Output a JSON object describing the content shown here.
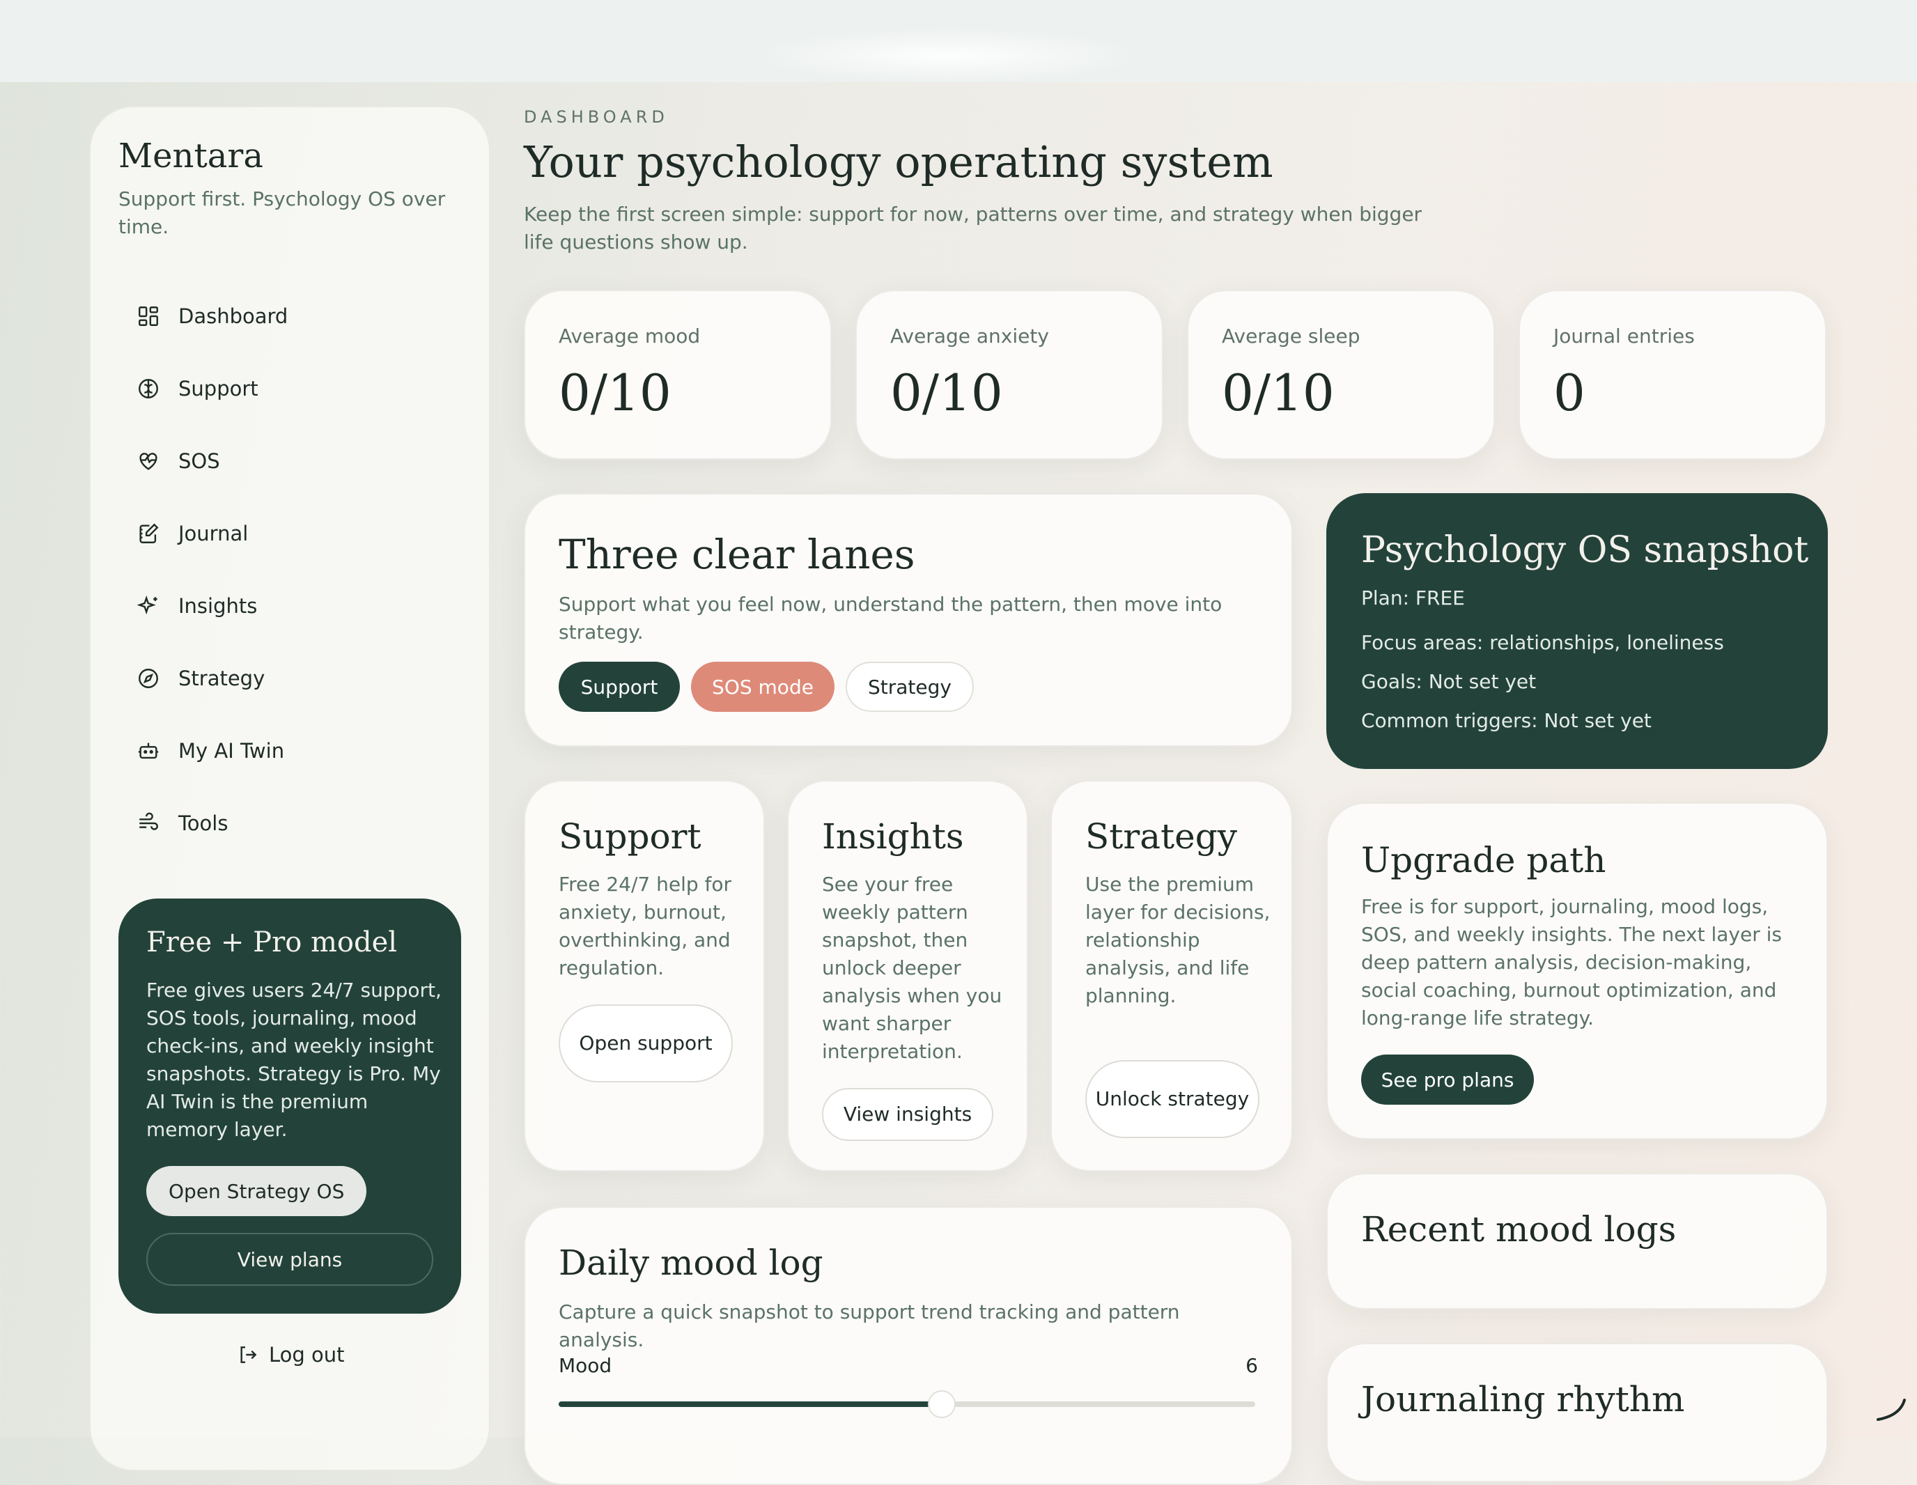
{
  "sidebar": {
    "brand": "Mentara",
    "tagline": "Support first. Psychology OS over time.",
    "items": [
      {
        "label": "Dashboard",
        "icon": "dashboard-icon"
      },
      {
        "label": "Support",
        "icon": "brain-icon"
      },
      {
        "label": "SOS",
        "icon": "heart-pulse-icon"
      },
      {
        "label": "Journal",
        "icon": "journal-icon"
      },
      {
        "label": "Insights",
        "icon": "sparkles-icon"
      },
      {
        "label": "Strategy",
        "icon": "compass-icon"
      },
      {
        "label": "My AI Twin",
        "icon": "bot-icon"
      },
      {
        "label": "Tools",
        "icon": "wind-icon"
      }
    ],
    "promo": {
      "title": "Free + Pro model",
      "text": "Free gives users 24/7 support, SOS tools, journaling, mood check-ins, and weekly insight snapshots. Strategy is Pro. My AI Twin is the premium memory layer.",
      "primary": "Open Strategy OS",
      "secondary": "View plans"
    },
    "logout": "Log out"
  },
  "header": {
    "eyebrow": "DASHBOARD",
    "title": "Your psychology operating system",
    "subtitle": "Keep the first screen simple: support for now, patterns over time, and strategy when bigger life questions show up."
  },
  "stats": [
    {
      "label": "Average mood",
      "value": "0/10"
    },
    {
      "label": "Average anxiety",
      "value": "0/10"
    },
    {
      "label": "Average sleep",
      "value": "0/10"
    },
    {
      "label": "Journal entries",
      "value": "0"
    }
  ],
  "lanes": {
    "title": "Three clear lanes",
    "text": "Support what you feel now, understand the pattern, then move into strategy.",
    "pills": [
      "Support",
      "SOS mode",
      "Strategy"
    ]
  },
  "features": [
    {
      "title": "Support",
      "text": "Free 24/7 help for anxiety, burnout, overthinking, and regulation.",
      "button": "Open support"
    },
    {
      "title": "Insights",
      "text": "See your free weekly pattern snapshot, then unlock deeper analysis when you want sharper interpretation.",
      "button": "View insights"
    },
    {
      "title": "Strategy",
      "text": "Use the premium layer for decisions, relationship analysis, and life planning.",
      "button": "Unlock strategy"
    }
  ],
  "mood_log": {
    "title": "Daily mood log",
    "text": "Capture a quick snapshot to support trend tracking and pattern analysis.",
    "label": "Mood",
    "value": 6,
    "fraction": 0.55
  },
  "snapshot": {
    "title": "Psychology OS snapshot",
    "plan": "Plan: FREE",
    "focus": "Focus areas: relationships, loneliness",
    "goals": "Goals: Not set yet",
    "triggers": "Common triggers: Not set yet"
  },
  "upgrade": {
    "title": "Upgrade path",
    "text": "Free is for support, journaling, mood logs, SOS, and weekly insights. The next layer is deep pattern analysis, decision-making, social coaching, burnout optimization, and long-range life strategy.",
    "button": "See pro plans"
  },
  "recent": {
    "title": "Recent mood logs"
  },
  "rhythm": {
    "title": "Journaling rhythm"
  },
  "colors": {
    "accent": "#23433a",
    "coral": "#de8a79",
    "muted": "#5a7268"
  }
}
